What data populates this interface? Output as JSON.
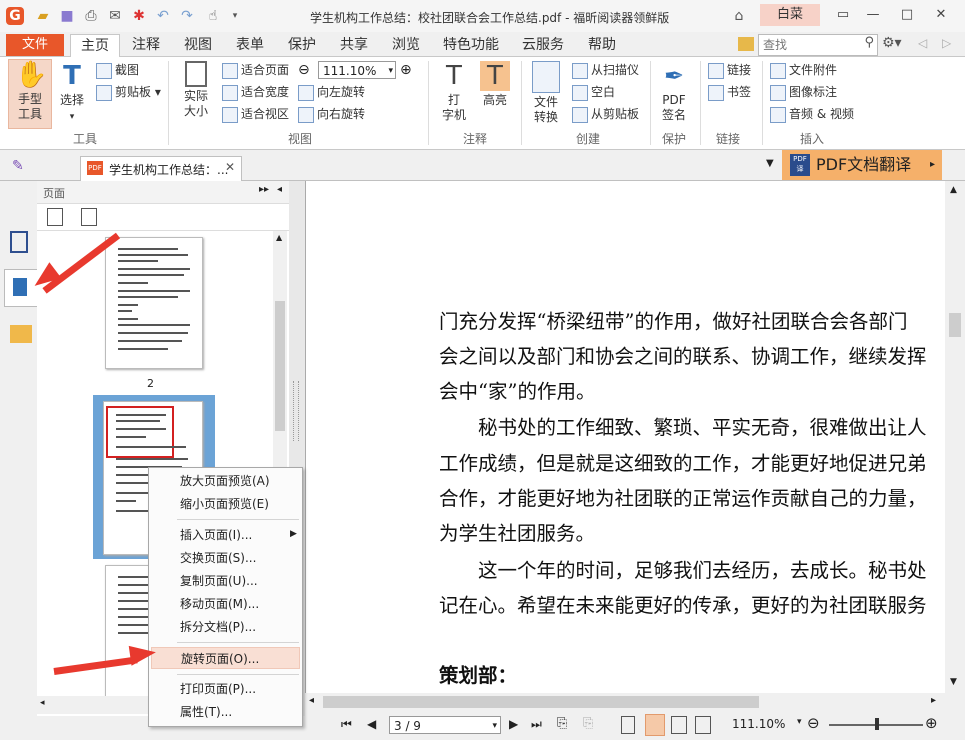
{
  "window": {
    "title": "学生机构工作总结：校社团联合会工作总结.pdf - 福昕阅读器领鲜版",
    "user": "白菜"
  },
  "menu_tabs": {
    "file": "文件",
    "tabs": [
      "主页",
      "注释",
      "视图",
      "表单",
      "保护",
      "共享",
      "浏览",
      "特色功能",
      "云服务",
      "帮助"
    ]
  },
  "search": {
    "placeholder": "查找"
  },
  "ribbon": {
    "hand": "手型\n工具",
    "select": "选择",
    "screenshot": "截图",
    "clipboard": "剪贴板",
    "group_tools": "工具",
    "actual_size": "实际\n大小",
    "fit_page": "适合页面",
    "fit_width": "适合宽度",
    "fit_view": "适合视区",
    "zoom_value": "111.10%",
    "rotate_left": "向左旋转",
    "rotate_right": "向右旋转",
    "group_view": "视图",
    "typewriter": "打\n字机",
    "highlight": "高亮",
    "group_comment": "注释",
    "file_convert": "文件\n转换",
    "from_scanner": "从扫描仪",
    "blank": "空白",
    "from_clipboard": "从剪贴板",
    "group_create": "创建",
    "pdf_sign": "PDF\n签名",
    "group_protect": "保护",
    "link": "链接",
    "bookmark": "书签",
    "group_link": "链接",
    "attachment": "文件附件",
    "image_annot": "图像标注",
    "audio_video": "音频 & 视频",
    "group_insert": "插入"
  },
  "doc_tab": {
    "label": "学生机构工作总结：..."
  },
  "translate": {
    "label": "PDF文档翻译"
  },
  "panel": {
    "title": "页面",
    "page_label": "2"
  },
  "context_menu": {
    "items": [
      "放大页面预览(A)",
      "缩小页面预览(E)",
      "插入页面(I)...",
      "交换页面(S)...",
      "复制页面(U)...",
      "移动页面(M)...",
      "拆分文档(P)...",
      "旋转页面(O)...",
      "打印页面(P)...",
      "属性(T)..."
    ]
  },
  "document": {
    "lines": [
      "门充分发挥“桥梁纽带”的作用，做好社团联合会各部门",
      "会之间以及部门和协会之间的联系、协调工作，继续发挥",
      "会中“家”的作用。",
      "　　秘书处的工作细致、繁琐、平实无奇，很难做出让人",
      "工作成绩，但是就是这细致的工作，才能更好地促进兄弟",
      "合作，才能更好地为社团联的正常运作贡献自己的力量，",
      "为学生社团服务。",
      "　　这一个年的时间，足够我们去经历，去成长。秘书处",
      "记在心。希望在未来能更好的传承，更好的为社团联服务"
    ],
    "heading": "策划部："
  },
  "status": {
    "page": "3 / 9",
    "zoom": "111.10%"
  },
  "colors": {
    "accent": "#e8572a",
    "highlight_menu": "#f9dfd4",
    "arrow": "#e8392e"
  }
}
